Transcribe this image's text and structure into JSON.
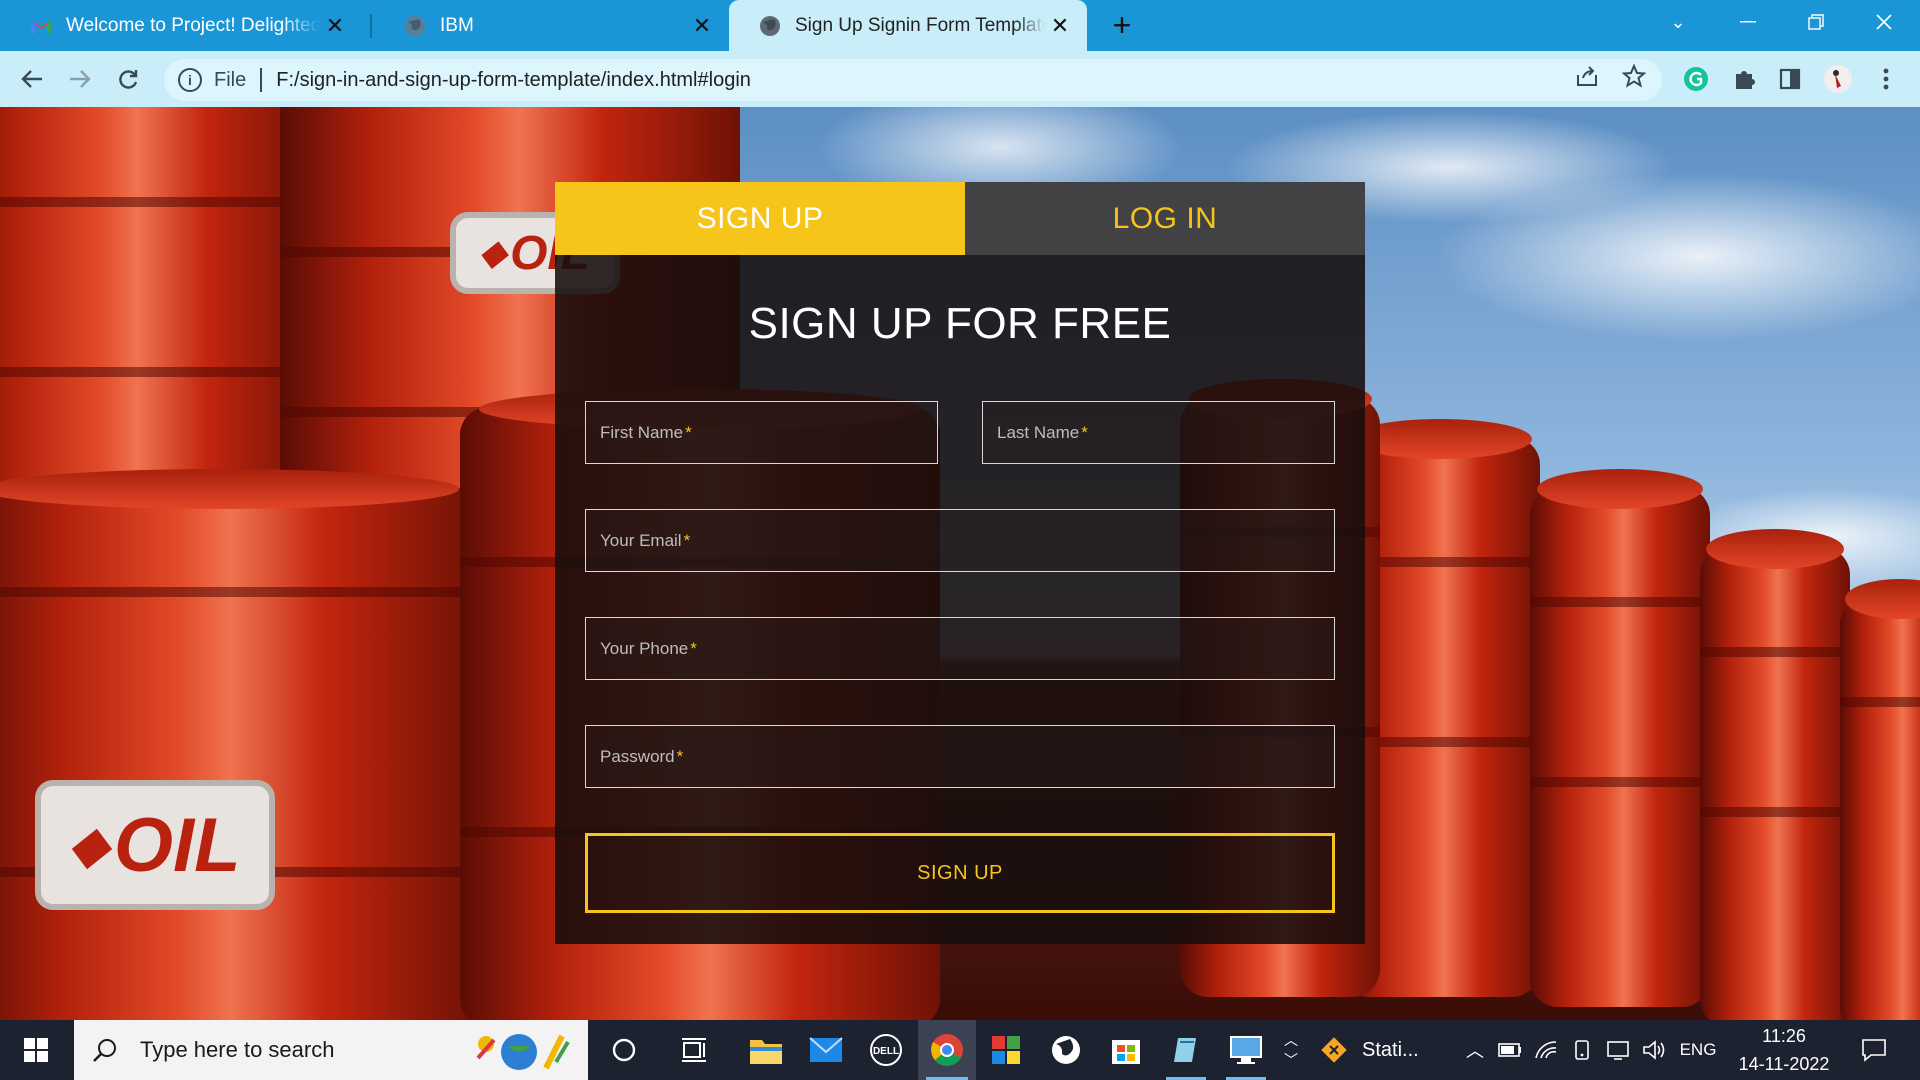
{
  "browser": {
    "tabs": [
      {
        "title": "Welcome to Project! Delighted to",
        "favicon": "gmail-icon",
        "active": false
      },
      {
        "title": "IBM",
        "favicon": "globe-icon",
        "active": false
      },
      {
        "title": "Sign Up Signin Form Template Ex",
        "favicon": "globe-icon",
        "active": true
      }
    ],
    "address": {
      "protocol_label": "File",
      "url": "F:/sign-in-and-sign-up-form-template/index.html#login"
    }
  },
  "form": {
    "tab_signup": "SIGN UP",
    "tab_login": "LOG IN",
    "heading": "SIGN UP FOR FREE",
    "fields": {
      "first_name": "First Name",
      "last_name": "Last Name",
      "email": "Your Email",
      "phone": "Your Phone",
      "password": "Password",
      "required_mark": "*"
    },
    "submit_label": "SIGN UP"
  },
  "background": {
    "barrel_label": "OIL"
  },
  "taskbar": {
    "search_placeholder": "Type here to search",
    "pinned_app_label": "Stati...",
    "language": "ENG",
    "time": "11:26",
    "date": "14-11-2022"
  },
  "colors": {
    "accent_yellow": "#f7c519",
    "tabstrip_blue": "#1a95d6",
    "toolbar_blue": "#c9eef9"
  }
}
